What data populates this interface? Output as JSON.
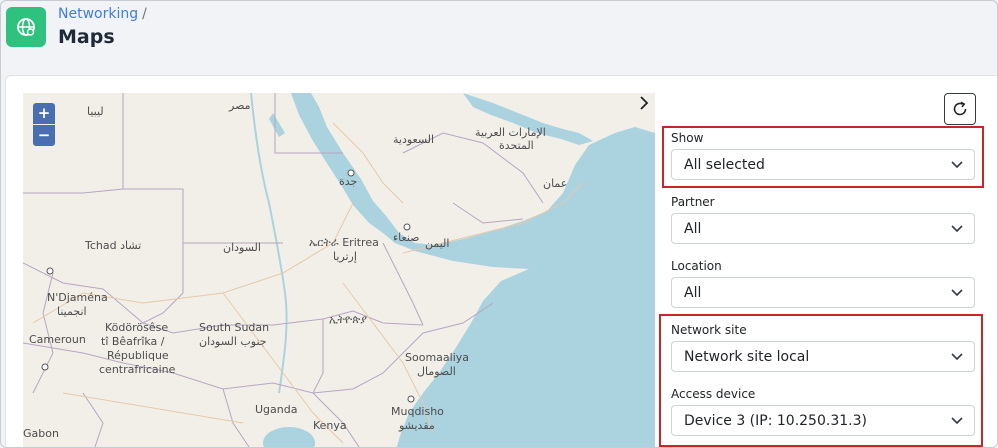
{
  "breadcrumb": {
    "parent": "Networking",
    "separator": "/"
  },
  "page_title": "Maps",
  "zoom": {
    "in_label": "+",
    "out_label": "−"
  },
  "filters": {
    "show": {
      "label": "Show",
      "value": "All selected"
    },
    "partner": {
      "label": "Partner",
      "value": "All"
    },
    "location": {
      "label": "Location",
      "value": "All"
    },
    "network_site": {
      "label": "Network site",
      "value": "Network site local"
    },
    "access_device": {
      "label": "Access device",
      "value": "Device 3 (IP: 10.250.31.3)"
    }
  },
  "map": {
    "labels": {
      "libya": "ليبيا",
      "egypt": "مصر",
      "saudi": "السعودية",
      "uae_1": "الإمارات العربية",
      "uae_2": "المتحدة",
      "jeddah": "جدة",
      "oman": "عمان",
      "tchad": "Tchad تشاد",
      "sudan": "السودان",
      "eritrea_1": "ኤርትራ Eritrea",
      "eritrea_2": "إرتريا",
      "sanaa": "صنعاء",
      "yemen": "اليمن",
      "ndjamena_1": "N'Djaména",
      "ndjamena_2": "انجمينا",
      "kodorosese": "Ködörösêse",
      "tiBeafrika": "tî Bêafrîka /",
      "republique": "République",
      "centrafricaine": "centrafricaine",
      "cameroun": "Cameroun",
      "south_sudan_1": "South Sudan",
      "south_sudan_2": "جنوب السودان",
      "ethiopia": "ኢትዮጵያ",
      "somalia_1": "Soomaaliya",
      "somalia_2": "الصومال",
      "mogadishu_1": "Muqdisho",
      "mogadishu_2": "مقديشو",
      "uganda": "Uganda",
      "kenya": "Kenya",
      "gabon": "Gabon"
    }
  },
  "colors": {
    "sea": "#aad3df",
    "land": "#f2efe9",
    "accent": "#3f7fd8",
    "highlight": "#c62828",
    "app_icon": "#2ec27e"
  }
}
